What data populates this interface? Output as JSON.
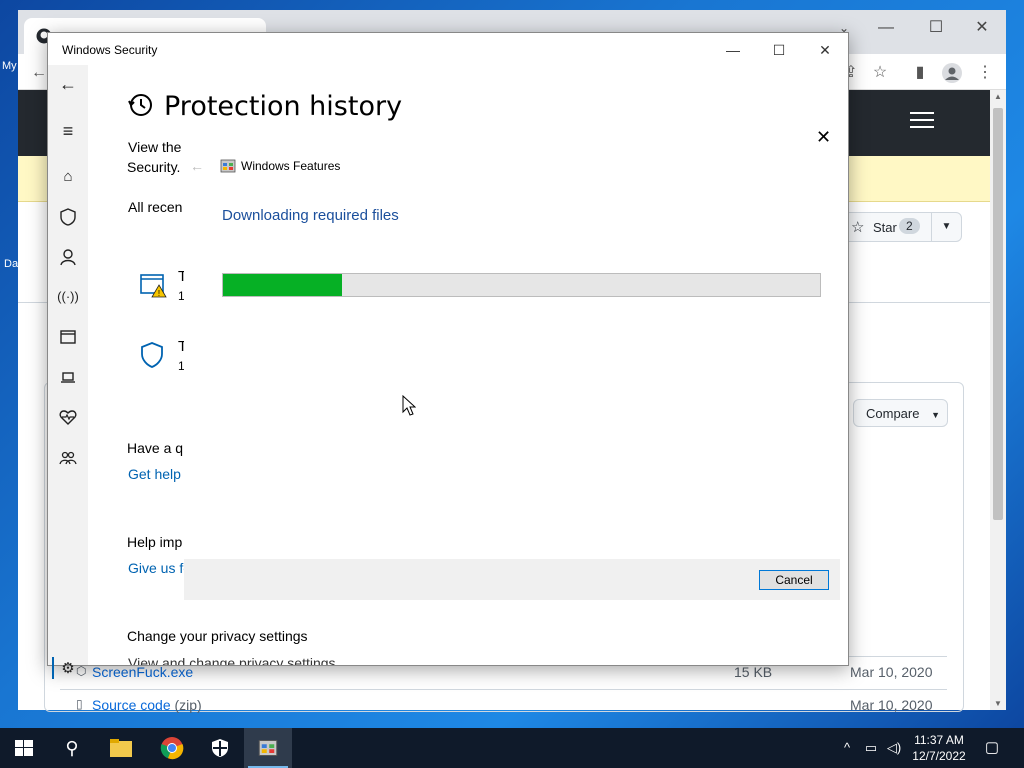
{
  "desktop": {
    "label_1": "My",
    "label_2": "Da"
  },
  "chrome": {
    "tab_title": "",
    "star_label": "Star",
    "star_count": "2",
    "compare_label": "Compare",
    "assets": [
      {
        "name": "ScreenFuck.exe",
        "ext": "",
        "size": "15 KB",
        "date": "Mar 10, 2020"
      },
      {
        "name": "Source code",
        "ext": "(zip)",
        "size": "",
        "date": "Mar 10, 2020"
      }
    ]
  },
  "windows_security": {
    "title": "Windows Security",
    "heading": "Protection history",
    "intro_line1": "View the",
    "intro_line2": "Security.",
    "all_recent": "All recen",
    "item1_letter": "T",
    "item1_sub": "1",
    "item2_letter": "T",
    "item2_sub": "1",
    "question": "Have a q",
    "get_help": "Get help",
    "help_improve": "Help imp",
    "give_us": "Give us fe",
    "privacy": "Change your privacy settings",
    "privacy_sub": "View and change privacy settings"
  },
  "windows_features": {
    "title": "Windows Features",
    "status": "Downloading required files",
    "progress": 0.2,
    "cancel_label": "Cancel"
  },
  "taskbar": {
    "time": "11:37 AM",
    "date": "12/7/2022"
  },
  "colors": {
    "accent": "#0063b1",
    "progress_fill": "#06b025",
    "taskbar": "#0f1a2a"
  }
}
